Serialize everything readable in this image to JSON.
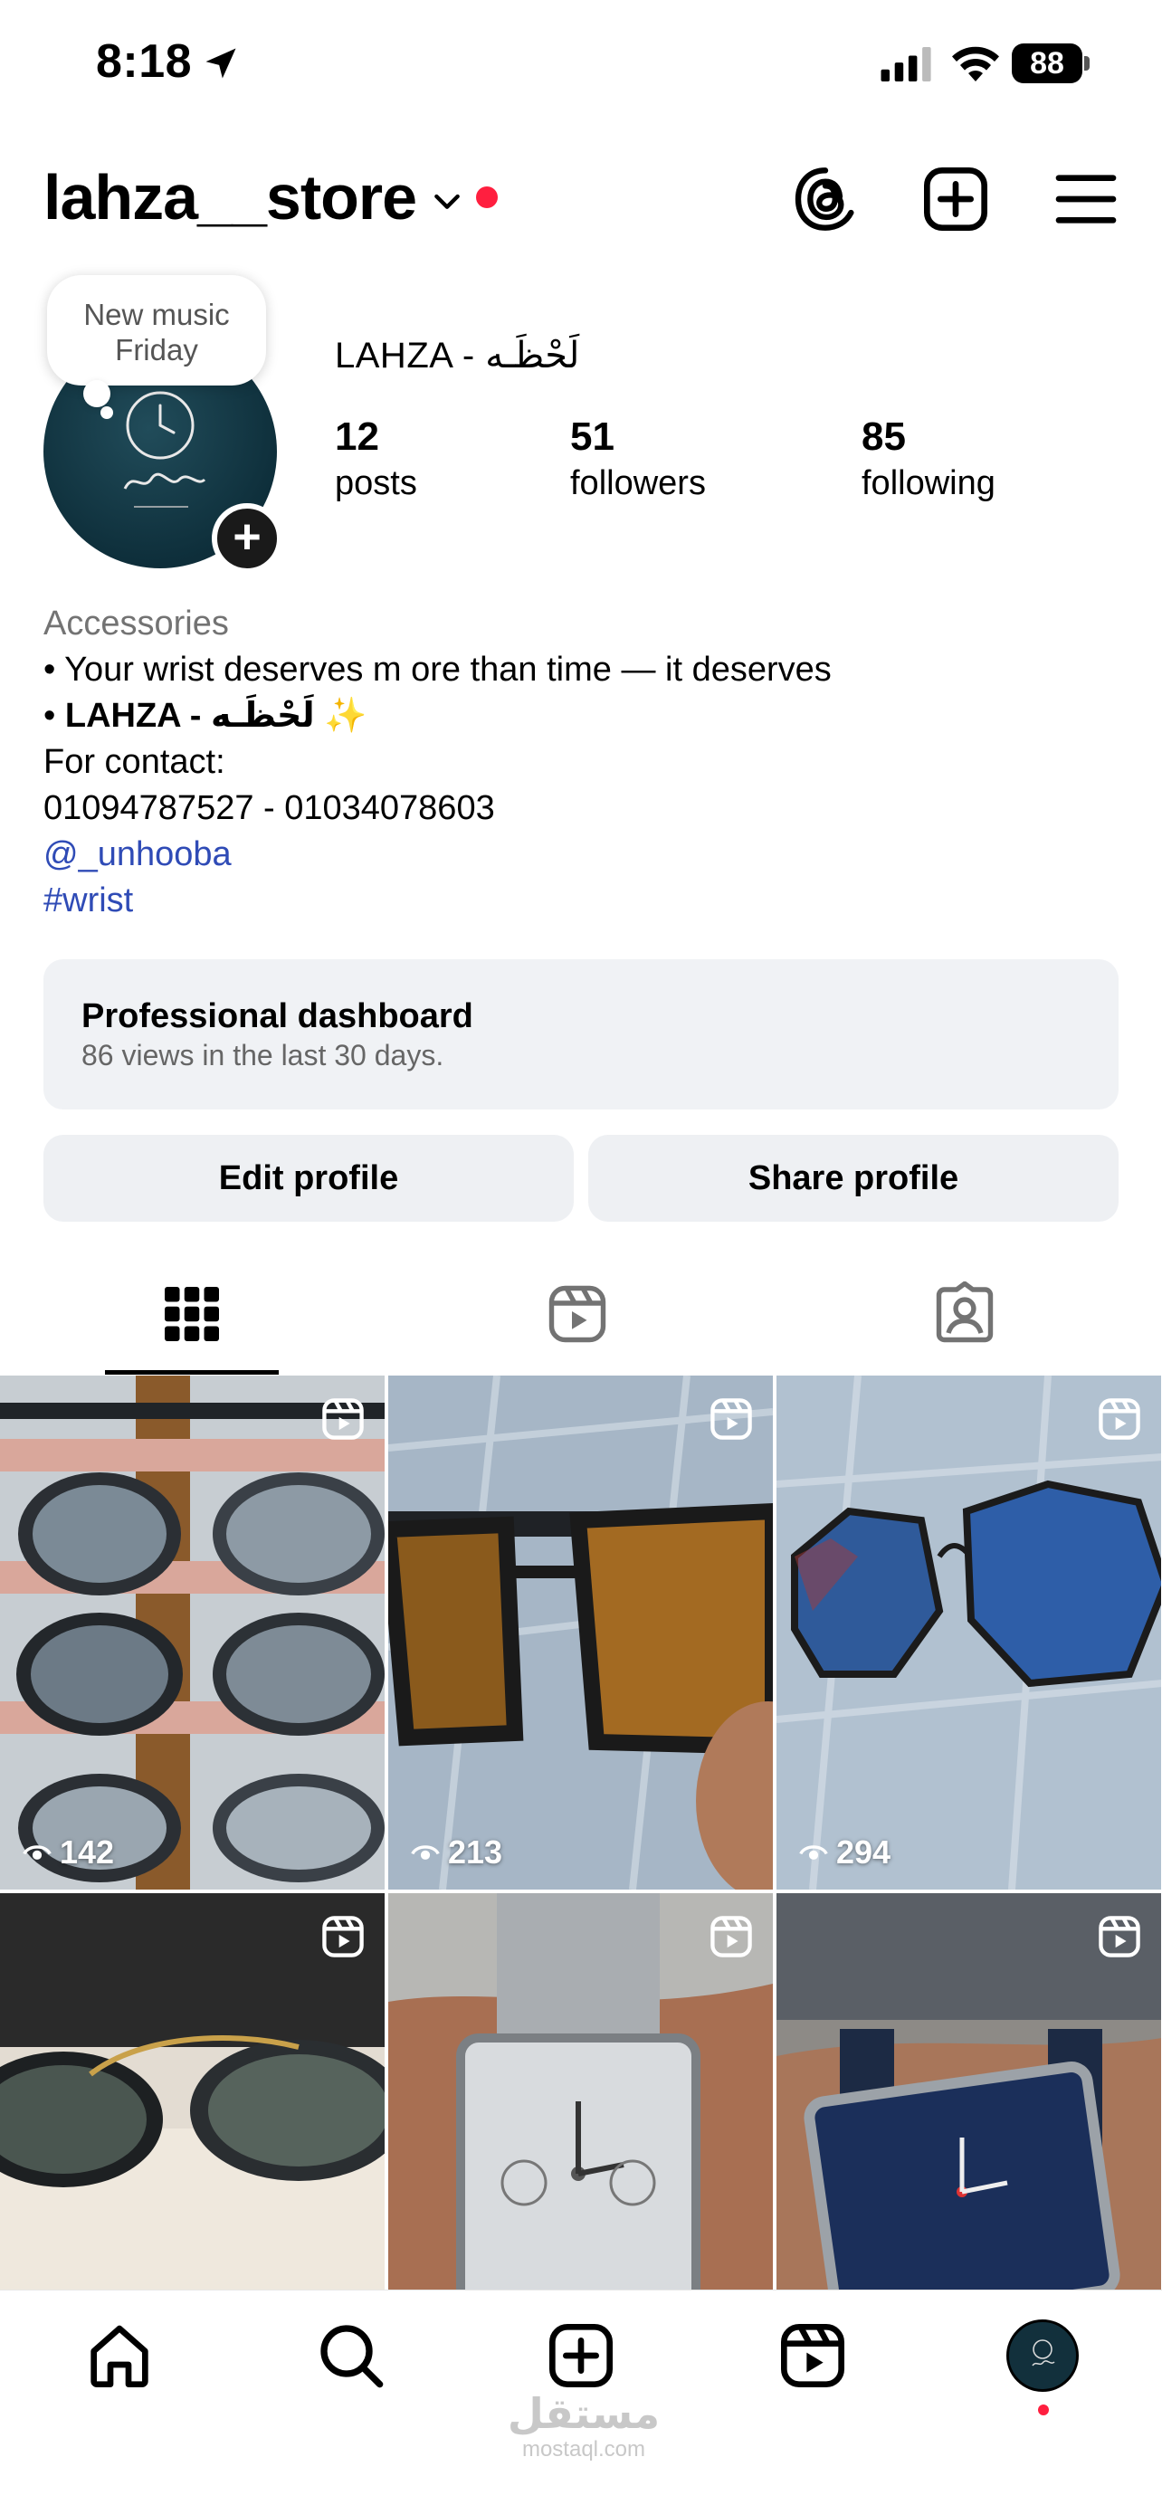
{
  "status_bar": {
    "time": "8:18",
    "battery": "88"
  },
  "header": {
    "username": "lahza__store"
  },
  "profile": {
    "note": "New music\nFriday",
    "display_name": "LAHZA - لَحْظَـه",
    "stats": [
      {
        "value": "12",
        "label": "posts"
      },
      {
        "value": "51",
        "label": "followers"
      },
      {
        "value": "85",
        "label": "following"
      }
    ],
    "bio": {
      "category": "Accessories",
      "line1": "• Your wrist deserves m ore than time — it deserves",
      "line2_prefix": "• ",
      "line2_bold": "LAHZA - لَحْظَـه",
      "line2_emoji": "✨",
      "line3": "For contact:",
      "line4": "01094787527 - 01034078603",
      "mention": "@_unhooba",
      "hashtag": "#wrist"
    }
  },
  "dashboard": {
    "title": "Professional dashboard",
    "subtitle": "86 views in the last 30 days."
  },
  "buttons": {
    "edit": "Edit profile",
    "share": "Share profile"
  },
  "posts": [
    {
      "views": "142"
    },
    {
      "views": "213"
    },
    {
      "views": "294"
    },
    {
      "views": ""
    },
    {
      "views": ""
    },
    {
      "views": ""
    }
  ],
  "watermark": {
    "arabic": "مستقل",
    "latin": "mostaql.com"
  },
  "colors": {
    "accent_link": "#2f4bb6",
    "notification": "#ff1f3f",
    "surface": "#f0f2f5"
  }
}
